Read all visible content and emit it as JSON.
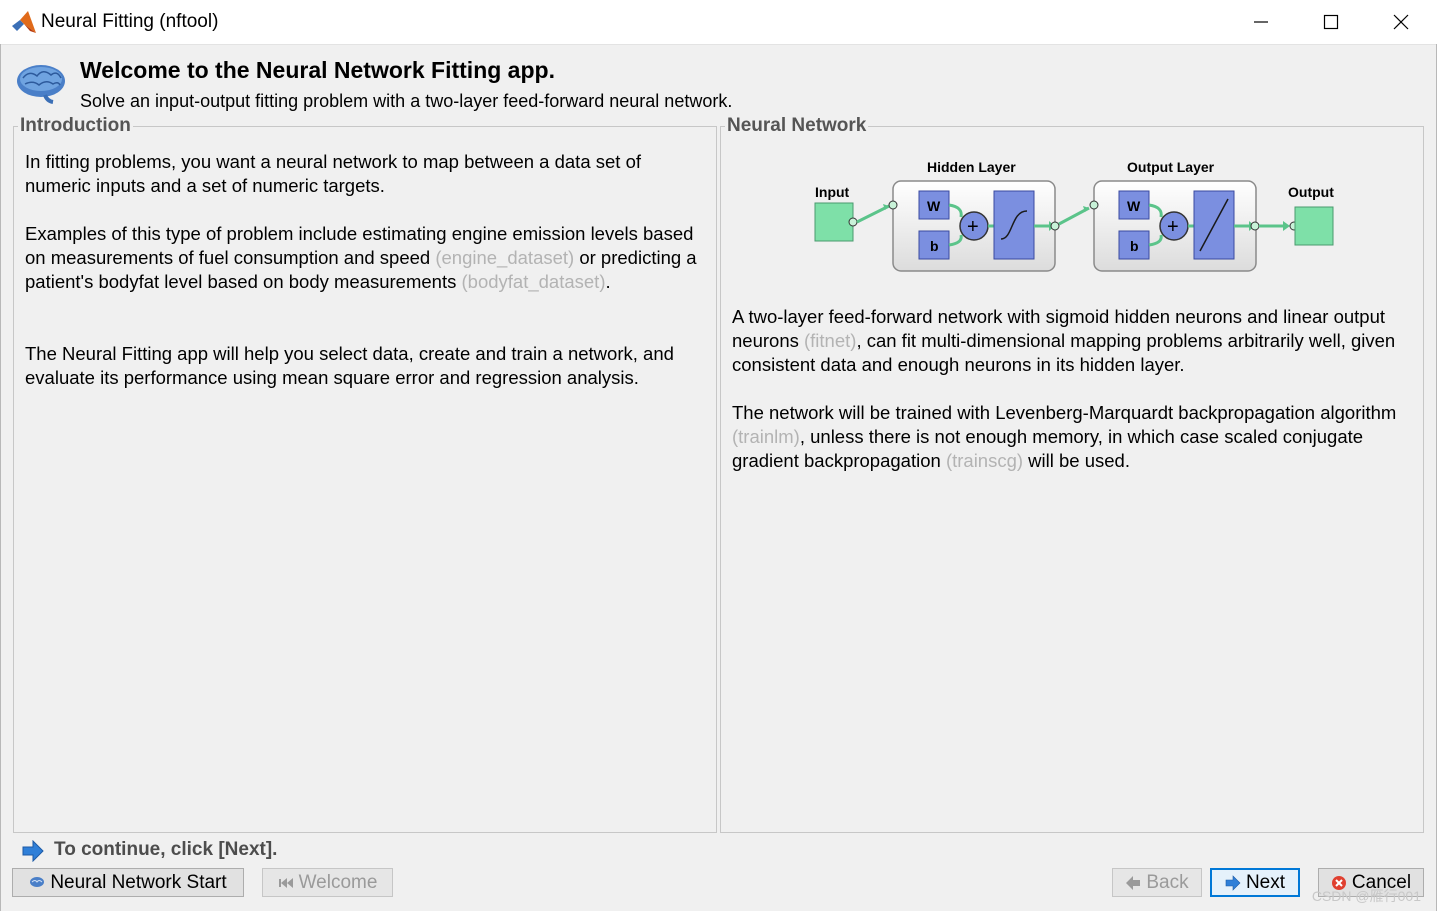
{
  "window": {
    "title": "Neural Fitting (nftool)"
  },
  "header": {
    "title": "Welcome to the Neural Network Fitting app.",
    "subtitle": "Solve an input-output fitting problem with a two-layer feed-forward neural network."
  },
  "introduction": {
    "legend": "Introduction",
    "p1": "In fitting problems, you want a neural network to map between a data set of numeric inputs and a set of numeric targets.",
    "p2_a": "Examples of this type of problem include estimating engine emission levels based on measurements of fuel consumption and speed ",
    "p2_link1": "(engine_dataset)",
    "p2_b": " or predicting a patient's bodyfat level based on body measurements ",
    "p2_link2": "(bodyfat_dataset)",
    "p2_c": ".",
    "p3": "The Neural Fitting app will help you select data, create and train a network, and evaluate its performance using mean square error and regression analysis."
  },
  "neural_network": {
    "legend": "Neural Network",
    "diagram": {
      "input_label": "Input",
      "hidden_label": "Hidden Layer",
      "output_layer_label": "Output Layer",
      "output_label": "Output",
      "weight": "W",
      "bias": "b",
      "plus": "+"
    },
    "p1_a": "A two-layer feed-forward network with sigmoid hidden neurons and linear output neurons ",
    "p1_link": "(fitnet)",
    "p1_b": ", can fit multi-dimensional mapping problems arbitrarily well, given consistent data and enough neurons in its hidden layer.",
    "p2_a": "The network will be trained with Levenberg-Marquardt backpropagation algorithm ",
    "p2_link1": "(trainlm)",
    "p2_b": ", unless there is not enough memory, in which case scaled conjugate gradient backpropagation ",
    "p2_link2": "(trainscg)",
    "p2_c": " will be used."
  },
  "footer": {
    "continue_text": "To continue, click [Next].",
    "nn_start_label": "Neural Network Start",
    "welcome_label": "Welcome",
    "back_label": "Back",
    "next_label": "Next",
    "cancel_label": "Cancel",
    "watermark": "CSDN @雁行001"
  },
  "colors": {
    "node_green": "#7ee0a8",
    "block_blue": "#7b8fe0",
    "link_gray": "#b3b3b3",
    "focus_blue": "#0078d7"
  }
}
